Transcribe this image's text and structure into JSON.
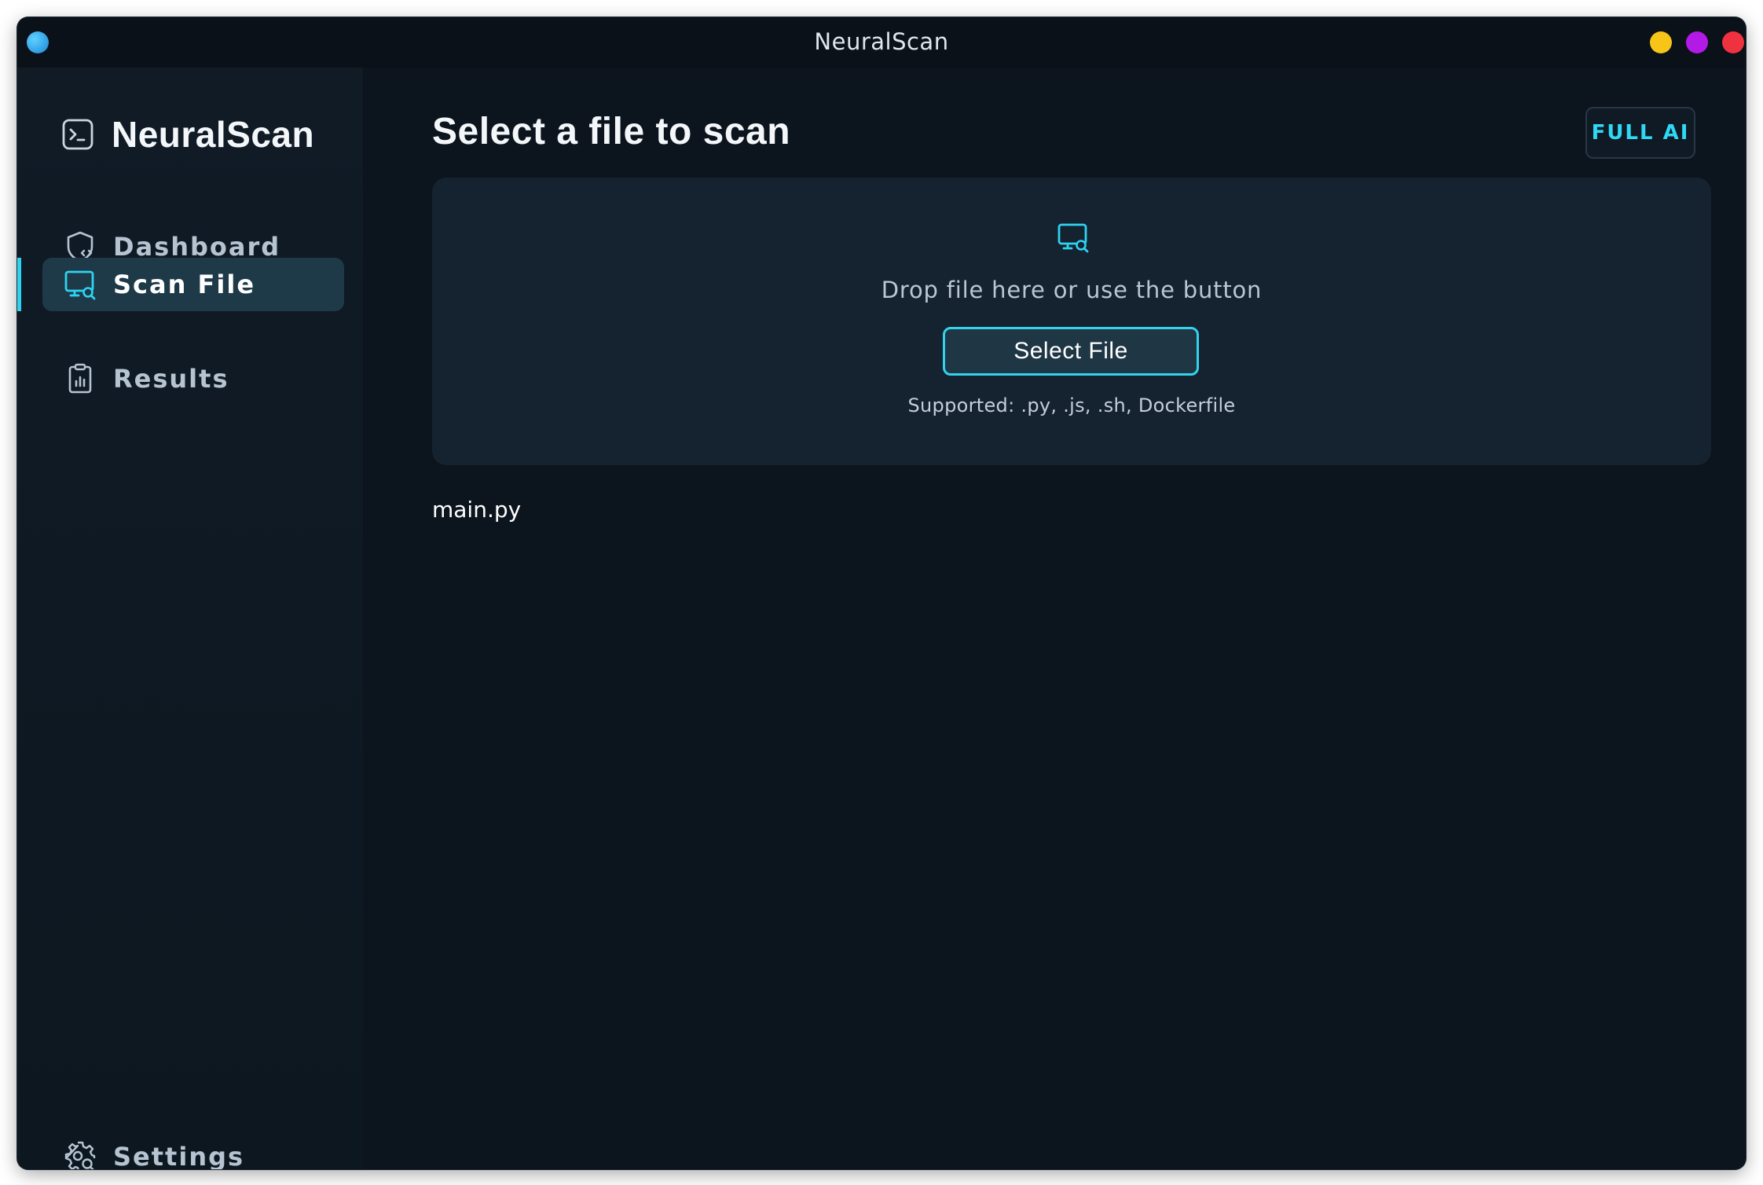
{
  "window": {
    "title": "NeuralScan"
  },
  "sidebar": {
    "brand": "NeuralScan",
    "items": [
      {
        "label": "Dashboard",
        "icon": "shield-code-icon",
        "active": false
      },
      {
        "label": "Scan File",
        "icon": "monitor-search-icon",
        "active": true
      },
      {
        "label": "Results",
        "icon": "clipboard-chart-icon",
        "active": false
      }
    ],
    "settings_label": "Settings"
  },
  "main": {
    "title": "Select a file to scan",
    "mode_badge": "FULL AI",
    "dropzone": {
      "instruction": "Drop file here or use the button",
      "button_label": "Select File",
      "supported": "Supported: .py, .js, .sh, Dockerfile"
    },
    "selected_file": "main.py"
  },
  "colors": {
    "accent": "#2ed3f0",
    "background": "#0c141d",
    "sidebar_active": "#1e3a48",
    "dropzone": "#152230"
  }
}
